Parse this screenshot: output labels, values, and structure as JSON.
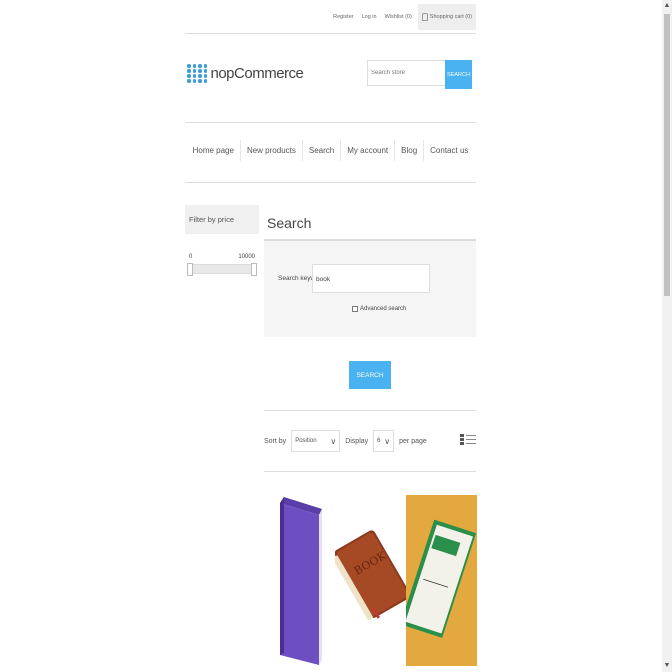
{
  "header": {
    "links": [
      {
        "key": "register",
        "label": "Register"
      },
      {
        "key": "login",
        "label": "Log in"
      },
      {
        "key": "wishlist",
        "label": "Wishlist (0)"
      }
    ],
    "cart_label": "Shopping cart (0)"
  },
  "logo": {
    "text": "nopCommerce"
  },
  "store_search": {
    "placeholder": "Search store",
    "button": "SEARCH"
  },
  "menu": [
    "Home page",
    "New products",
    "Search",
    "My account",
    "Blog",
    "Contact us"
  ],
  "sidebar": {
    "title": "Filter by price",
    "min": "0",
    "max": "10000"
  },
  "main": {
    "title": "Search",
    "keyword_label": "Search keyword:",
    "keyword_value": "book",
    "advanced_label": "Advanced search",
    "search_button": "SEARCH",
    "sort_label": "Sort by",
    "sort_value": "Position",
    "display_label": "Display",
    "display_value": "6",
    "per_page_label": "per page"
  },
  "colors": {
    "accent": "#4ab2f1"
  },
  "products": [
    {
      "image": "purple-book"
    },
    {
      "image": "brown-book"
    },
    {
      "image": "green-book"
    }
  ]
}
